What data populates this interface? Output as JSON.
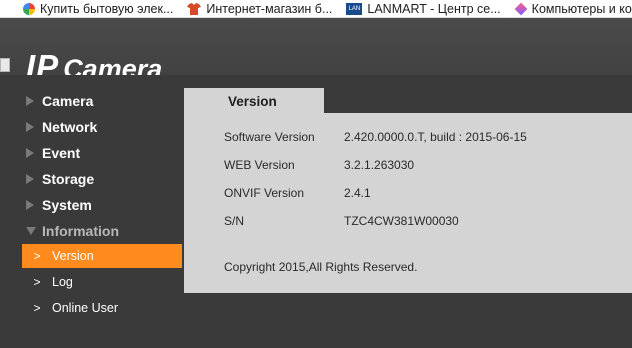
{
  "bookmarks": [
    {
      "icon": "google-icon",
      "label": "Купить бытовую элек..."
    },
    {
      "icon": "clothes-icon",
      "label": "Интернет-магазин б..."
    },
    {
      "icon": "lanmart-icon",
      "label": "LANMART - Центр се..."
    },
    {
      "icon": "diamond-icon",
      "label": "Компьютеры и ком"
    }
  ],
  "header": {
    "logo_ip": "IP",
    "logo_camera": "Camera"
  },
  "sidebar": {
    "items": [
      {
        "label": "Camera"
      },
      {
        "label": "Network"
      },
      {
        "label": "Event"
      },
      {
        "label": "Storage"
      },
      {
        "label": "System"
      },
      {
        "label": "Information"
      }
    ],
    "subitems": [
      {
        "label": "Version",
        "active": true
      },
      {
        "label": "Log"
      },
      {
        "label": "Online User"
      }
    ]
  },
  "content": {
    "tab": "Version",
    "rows": [
      {
        "label": "Software Version",
        "value": "2.420.0000.0.T, build : 2015-06-15"
      },
      {
        "label": "WEB Version",
        "value": "3.2.1.263030"
      },
      {
        "label": "ONVIF Version",
        "value": "2.4.1"
      },
      {
        "label": "S/N",
        "value": "TZC4CW381W00030"
      }
    ],
    "copyright": "Copyright 2015,All Rights Reserved."
  },
  "colors": {
    "accent": "#ff8a1e",
    "header_bg": "#4a4a4a",
    "panel_bg": "#d4d4d4",
    "sidebar_bg": "#3a3a3a"
  }
}
